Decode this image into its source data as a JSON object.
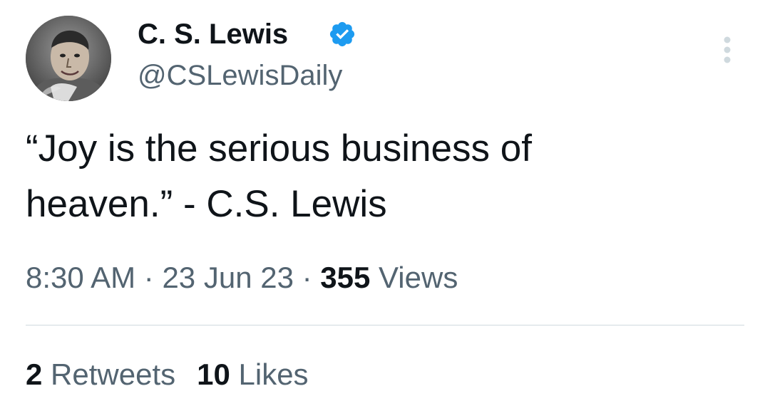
{
  "author": {
    "display_name": "C. S. Lewis",
    "handle": "@CSLewisDaily",
    "verified": true,
    "verified_color": "#1d9bf0",
    "avatar_icon": "user-avatar"
  },
  "tweet": {
    "text_lines": [
      "“Joy is the serious business of",
      "heaven.” - C.S. Lewis"
    ]
  },
  "meta": {
    "time": "8:30 AM",
    "separator": "·",
    "date": "23 Jun 23",
    "views_count": "355",
    "views_label": "Views"
  },
  "stats": {
    "retweets_count": "2",
    "retweets_label": "Retweets",
    "likes_count": "10",
    "likes_label": "Likes"
  },
  "more_menu_icon": "more-vertical-icon"
}
